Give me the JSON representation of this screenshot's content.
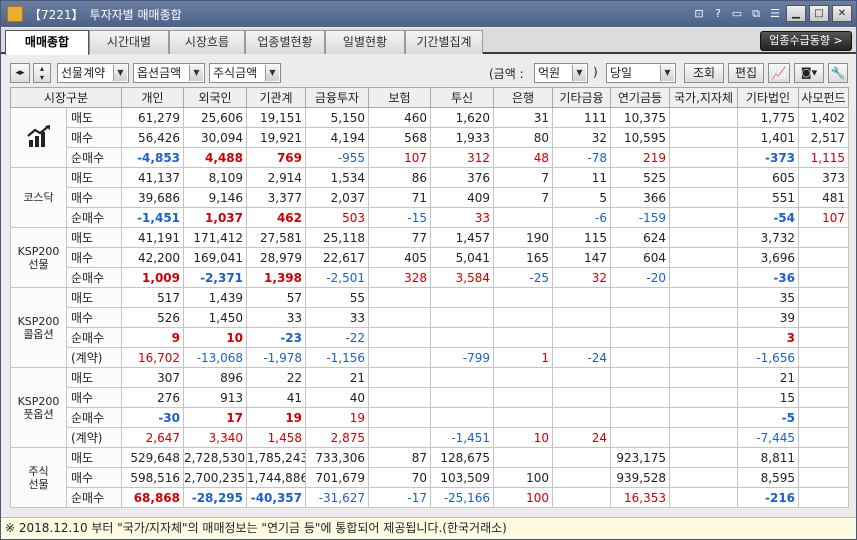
{
  "window": {
    "code": "【7221】",
    "title": "투자자별 매매종합",
    "title_icons": [
      "pin-icon",
      "help-icon",
      "screen-icon",
      "link-icon",
      "menu-icon"
    ],
    "controls": [
      "minimize",
      "maximize",
      "close"
    ]
  },
  "tabs": [
    "매매종합",
    "시간대별",
    "시장흐름",
    "업종별현황",
    "일별현황",
    "기간별집계"
  ],
  "active_tab": 0,
  "right_button": "업종수급동향 >",
  "toolbar": {
    "combo1": "선물계약",
    "combo2": "옵션금액",
    "combo3": "주식금액",
    "amount_label": "(금액 :",
    "amount_unit": "억원",
    "amount_close": ")",
    "period": "당일",
    "query_button": "조회",
    "edit_button": "편집"
  },
  "columns": [
    "시장구분",
    "",
    "개인",
    "외국인",
    "기관계",
    "금융투자",
    "보험",
    "투신",
    "은행",
    "기타금융",
    "연기금등",
    "국가,지자체",
    "기타법인",
    "사모펀드"
  ],
  "groups": [
    {
      "name": "",
      "icon": "chart-bars-icon",
      "rows": [
        {
          "label": "매도",
          "values": [
            "61,279",
            "25,606",
            "19,151",
            "5,150",
            "460",
            "1,620",
            "31",
            "111",
            "10,375",
            "",
            "1,775",
            "1,402"
          ]
        },
        {
          "label": "매수",
          "values": [
            "56,426",
            "30,094",
            "19,921",
            "4,194",
            "568",
            "1,933",
            "80",
            "32",
            "10,595",
            "",
            "1,401",
            "2,517"
          ]
        },
        {
          "label": "순매수",
          "values": [
            "-4,853",
            "4,488",
            "769",
            "-955",
            "107",
            "312",
            "48",
            "-78",
            "219",
            "",
            "-373",
            "1,115"
          ]
        }
      ]
    },
    {
      "name": "코스닥",
      "rows": [
        {
          "label": "매도",
          "values": [
            "41,137",
            "8,109",
            "2,914",
            "1,534",
            "86",
            "376",
            "7",
            "11",
            "525",
            "",
            "605",
            "373"
          ]
        },
        {
          "label": "매수",
          "values": [
            "39,686",
            "9,146",
            "3,377",
            "2,037",
            "71",
            "409",
            "7",
            "5",
            "366",
            "",
            "551",
            "481"
          ]
        },
        {
          "label": "순매수",
          "values": [
            "-1,451",
            "1,037",
            "462",
            "503",
            "-15",
            "33",
            "",
            "-6",
            "-159",
            "",
            "-54",
            "107"
          ]
        }
      ]
    },
    {
      "name": "KSP200\n선물",
      "rows": [
        {
          "label": "매도",
          "values": [
            "41,191",
            "171,412",
            "27,581",
            "25,118",
            "77",
            "1,457",
            "190",
            "115",
            "624",
            "",
            "3,732",
            ""
          ]
        },
        {
          "label": "매수",
          "values": [
            "42,200",
            "169,041",
            "28,979",
            "22,617",
            "405",
            "5,041",
            "165",
            "147",
            "604",
            "",
            "3,696",
            ""
          ]
        },
        {
          "label": "순매수",
          "values": [
            "1,009",
            "-2,371",
            "1,398",
            "-2,501",
            "328",
            "3,584",
            "-25",
            "32",
            "-20",
            "",
            "-36",
            ""
          ]
        }
      ]
    },
    {
      "name": "KSP200\n콜옵션",
      "rows": [
        {
          "label": "매도",
          "values": [
            "517",
            "1,439",
            "57",
            "55",
            "",
            "",
            "",
            "",
            "",
            "",
            "35",
            ""
          ]
        },
        {
          "label": "매수",
          "values": [
            "526",
            "1,450",
            "33",
            "33",
            "",
            "",
            "",
            "",
            "",
            "",
            "39",
            ""
          ]
        },
        {
          "label": "순매수",
          "values": [
            "9",
            "10",
            "-23",
            "-22",
            "",
            "",
            "",
            "",
            "",
            "",
            "3",
            ""
          ]
        },
        {
          "label": "(계약)",
          "values": [
            "16,702",
            "-13,068",
            "-1,978",
            "-1,156",
            "",
            "-799",
            "1",
            "-24",
            "",
            "",
            "-1,656",
            ""
          ]
        }
      ]
    },
    {
      "name": "KSP200\n풋옵션",
      "rows": [
        {
          "label": "매도",
          "values": [
            "307",
            "896",
            "22",
            "21",
            "",
            "",
            "",
            "",
            "",
            "",
            "21",
            ""
          ]
        },
        {
          "label": "매수",
          "values": [
            "276",
            "913",
            "41",
            "40",
            "",
            "",
            "",
            "",
            "",
            "",
            "15",
            ""
          ]
        },
        {
          "label": "순매수",
          "values": [
            "-30",
            "17",
            "19",
            "19",
            "",
            "",
            "",
            "",
            "",
            "",
            "-5",
            ""
          ]
        },
        {
          "label": "(계약)",
          "values": [
            "2,647",
            "3,340",
            "1,458",
            "2,875",
            "",
            "-1,451",
            "10",
            "24",
            "",
            "",
            "-7,445",
            ""
          ]
        }
      ]
    },
    {
      "name": "주식\n선물",
      "rows": [
        {
          "label": "매도",
          "values": [
            "529,648",
            "2,728,530",
            "1,785,243",
            "733,306",
            "87",
            "128,675",
            "",
            "",
            "923,175",
            "",
            "8,811",
            ""
          ]
        },
        {
          "label": "매수",
          "values": [
            "598,516",
            "2,700,235",
            "1,744,886",
            "701,679",
            "70",
            "103,509",
            "100",
            "",
            "939,528",
            "",
            "8,595",
            ""
          ]
        },
        {
          "label": "순매수",
          "values": [
            "68,868",
            "-28,295",
            "-40,357",
            "-31,627",
            "-17",
            "-25,166",
            "100",
            "",
            "16,353",
            "",
            "-216",
            ""
          ]
        }
      ]
    }
  ],
  "footer": "※ 2018.12.10 부터 \"국가/지자체\"의 매매정보는 \"연기금 등\"에 통합되어 제공됩니다.(한국거래소)",
  "colors": {
    "positive": "#d00000",
    "negative": "#1a5fd0"
  }
}
